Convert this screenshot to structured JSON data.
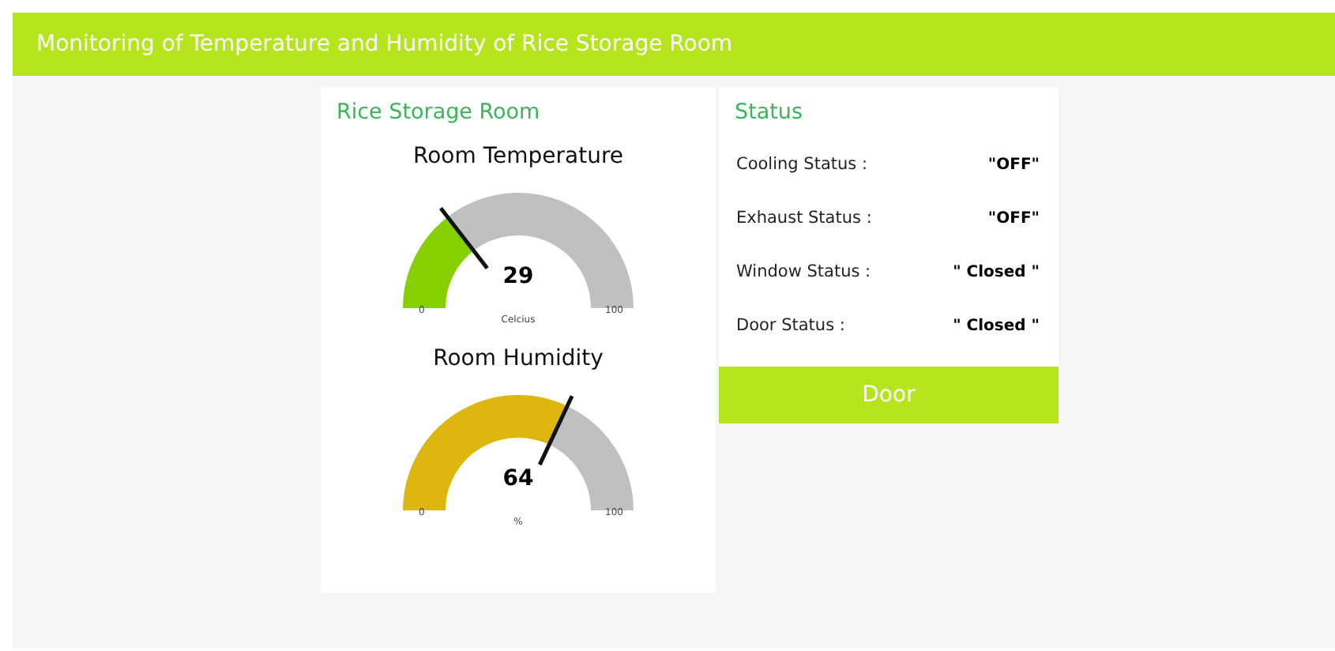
{
  "header": {
    "title": "Monitoring of Temperature and Humidity of Rice Storage Room"
  },
  "room_card": {
    "title": "Rice Storage Room",
    "gauges": [
      {
        "title": "Room Temperature",
        "value": "29",
        "unit": "Celcius",
        "min": "0",
        "max": "100",
        "level": 0.29,
        "color": "#86d000"
      },
      {
        "title": "Room Humidity",
        "value": "64",
        "unit": "%",
        "min": "0",
        "max": "100",
        "level": 0.64,
        "color": "#ddb60f"
      }
    ]
  },
  "status_card": {
    "title": "Status",
    "rows": [
      {
        "label": "Cooling Status :",
        "value": "\"OFF\""
      },
      {
        "label": "Exhaust Status :",
        "value": "\"OFF\""
      },
      {
        "label": "Window Status :",
        "value": "\" Closed \""
      },
      {
        "label": "Door Status :",
        "value": "\" Closed \""
      }
    ],
    "button": "Door"
  }
}
